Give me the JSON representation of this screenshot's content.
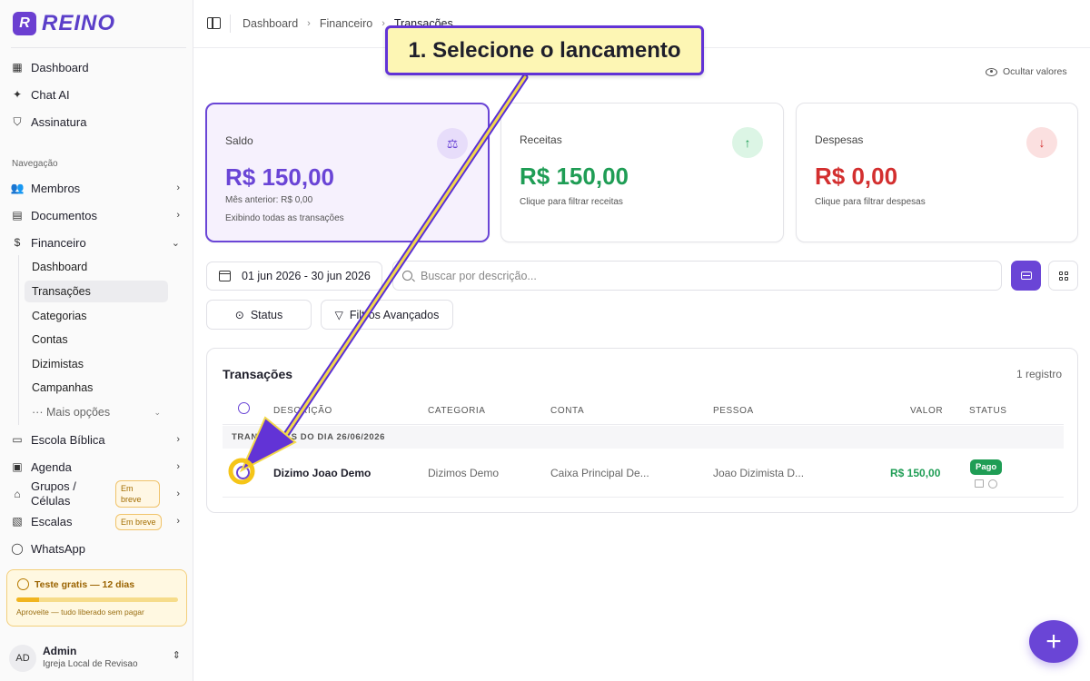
{
  "brand": {
    "name": "REINO",
    "mark": "R"
  },
  "sidebar": {
    "top_items": [
      {
        "label": "Dashboard",
        "icon": "grid-icon"
      },
      {
        "label": "Chat AI",
        "icon": "sparkle-icon"
      },
      {
        "label": "Assinatura",
        "icon": "shield-icon"
      }
    ],
    "section_label": "Navegação",
    "items": [
      {
        "label": "Membros",
        "icon": "users-icon"
      },
      {
        "label": "Documentos",
        "icon": "document-icon"
      },
      {
        "label": "Financeiro",
        "icon": "dollar-icon"
      }
    ],
    "finance_sub": [
      {
        "label": "Dashboard"
      },
      {
        "label": "Transações"
      },
      {
        "label": "Categorias"
      },
      {
        "label": "Contas"
      },
      {
        "label": "Dizimistas"
      },
      {
        "label": "Campanhas"
      },
      {
        "label": "··· Mais opções"
      }
    ],
    "lower_items": [
      {
        "label": "Escola Bíblica",
        "icon": "book-icon"
      },
      {
        "label": "Agenda",
        "icon": "calendar-icon"
      },
      {
        "label": "Grupos / Células",
        "icon": "home-icon",
        "badge": "Em breve"
      },
      {
        "label": "Escalas",
        "icon": "schedule-icon",
        "badge": "Em breve"
      },
      {
        "label": "WhatsApp",
        "icon": "whatsapp-icon"
      }
    ],
    "trial": {
      "title": "Teste gratis — 12 dias",
      "subtitle": "Aproveite — tudo liberado sem pagar",
      "progress": 0.14,
      "color": "#f1b520"
    },
    "user": {
      "initials": "AD",
      "name": "Admin",
      "org": "Igreja Local de Revisao"
    }
  },
  "breadcrumb": {
    "items": [
      "Dashboard",
      "Financeiro"
    ],
    "current": "Transações"
  },
  "hide_values_label": "Ocultar valores",
  "cards": {
    "saldo": {
      "label": "Saldo",
      "value": "R$ 150,00",
      "sub1": "Mês anterior: R$ 0,00",
      "sub2": "Exibindo todas as transações",
      "color": "#6a45d6"
    },
    "receitas": {
      "label": "Receitas",
      "value": "R$ 150,00",
      "sub1": "Clique para filtrar receitas",
      "color": "#1f9d55"
    },
    "despesas": {
      "label": "Despesas",
      "value": "R$ 0,00",
      "sub1": "Clique para filtrar despesas",
      "color": "#d32f2f"
    }
  },
  "filters": {
    "date_range": "01 jun 2026 - 30 jun 2026",
    "search_placeholder": "Buscar por descrição...",
    "status_label": "Status",
    "advanced_label": "Filtros Avançados"
  },
  "table": {
    "title": "Transações",
    "count": "1 registro",
    "columns": [
      "DESCRIÇÃO",
      "CATEGORIA",
      "CONTA",
      "PESSOA",
      "VALOR",
      "STATUS"
    ],
    "group_label": "TRANSAÇÕES DO DIA 26/06/2026",
    "rows": [
      {
        "descricao": "Dizimo Joao Demo",
        "categoria": "Dizimos Demo",
        "conta": "Caixa Principal De...",
        "pessoa": "Joao Dizimista D...",
        "valor": "R$ 150,00",
        "status": "Pago"
      }
    ]
  },
  "annotation": {
    "text": "1. Selecione o lancamento"
  },
  "fab_label": "+"
}
